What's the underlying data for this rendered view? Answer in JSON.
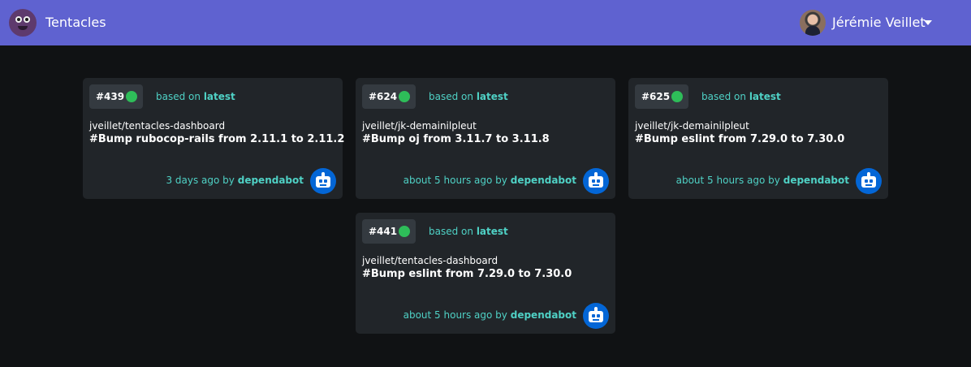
{
  "navbar": {
    "brand": "Tentacles",
    "user_name": "Jérémie Veillet"
  },
  "pull_requests": [
    {
      "number": "#439",
      "status_color": "#2ebd59",
      "based_on_prefix": "based on",
      "base": "latest",
      "repo": "jveillet/tentacles-dashboard",
      "title": "#Bump rubocop-rails from 2.11.1 to 2.11.2",
      "time": "3 days ago by",
      "author": "dependabot"
    },
    {
      "number": "#624",
      "status_color": "#2ebd59",
      "based_on_prefix": "based on",
      "base": "latest",
      "repo": "jveillet/jk-demainilpleut",
      "title": "#Bump oj from 3.11.7 to 3.11.8",
      "time": "about 5 hours ago by",
      "author": "dependabot"
    },
    {
      "number": "#625",
      "status_color": "#2ebd59",
      "based_on_prefix": "based on",
      "base": "latest",
      "repo": "jveillet/jk-demainilpleut",
      "title": "#Bump eslint from 7.29.0 to 7.30.0",
      "time": "about 5 hours ago by",
      "author": "dependabot"
    },
    {
      "number": "#441",
      "status_color": "#2ebd59",
      "based_on_prefix": "based on",
      "base": "latest",
      "repo": "jveillet/tentacles-dashboard",
      "title": "#Bump eslint from 7.29.0 to 7.30.0",
      "time": "about 5 hours ago by",
      "author": "dependabot"
    }
  ],
  "colors": {
    "navbar": "#5f62d0",
    "background": "#101214",
    "card": "#212529",
    "accent": "#4fd1c5",
    "bot": "#0366d6"
  }
}
